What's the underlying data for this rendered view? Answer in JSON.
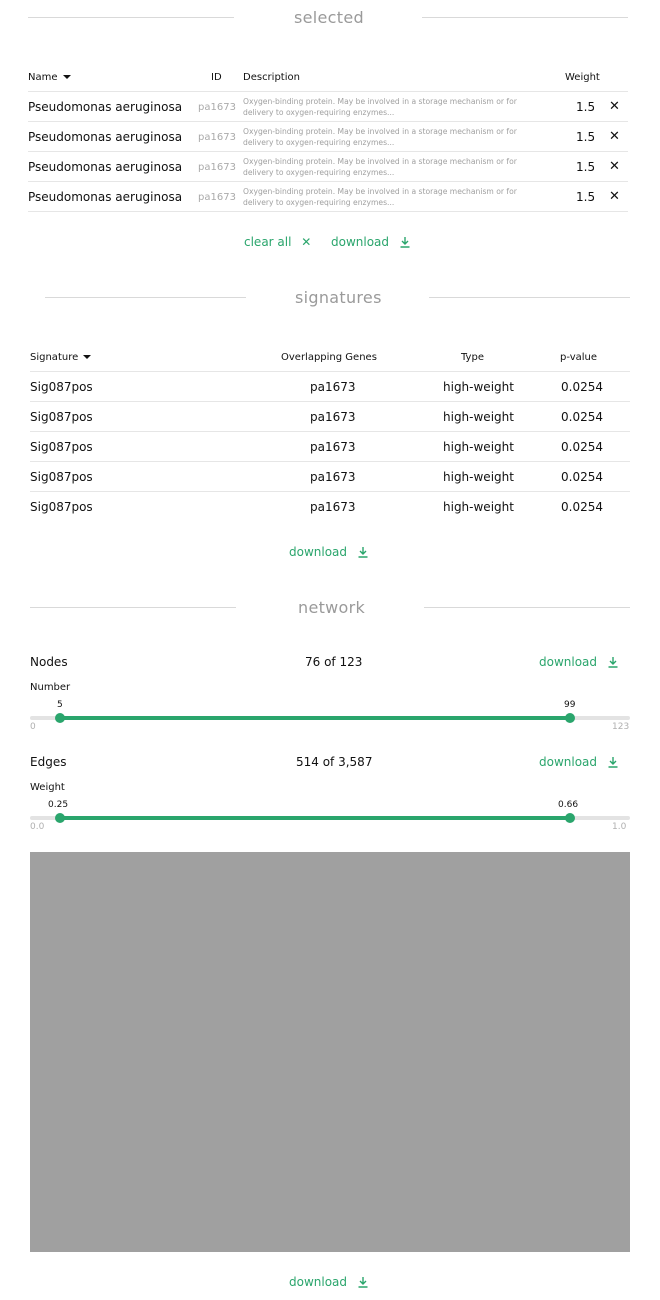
{
  "selected": {
    "title": "selected",
    "headers": {
      "name": "Name",
      "id": "ID",
      "description": "Description",
      "weight": "Weight"
    },
    "rows": [
      {
        "name": "Pseudomonas aeruginosa",
        "id": "pa1673",
        "desc_line1": "Oxygen-binding protein. May be involved in a storage mechanism or for",
        "desc_line2": "delivery to oxygen-requiring enzymes...",
        "weight": "1.5"
      },
      {
        "name": "Pseudomonas aeruginosa",
        "id": "pa1673",
        "desc_line1": "Oxygen-binding protein. May be involved in a storage mechanism or for",
        "desc_line2": "delivery to oxygen-requiring enzymes...",
        "weight": "1.5"
      },
      {
        "name": "Pseudomonas aeruginosa",
        "id": "pa1673",
        "desc_line1": "Oxygen-binding protein. May be involved in a storage mechanism or for",
        "desc_line2": "delivery to oxygen-requiring enzymes...",
        "weight": "1.5"
      },
      {
        "name": "Pseudomonas aeruginosa",
        "id": "pa1673",
        "desc_line1": "Oxygen-binding protein. May be involved in a storage mechanism or for",
        "desc_line2": "delivery to oxygen-requiring enzymes...",
        "weight": "1.5"
      }
    ],
    "remove_glyph": "✕",
    "clear_all_label": "clear all",
    "download_label": "download"
  },
  "signatures": {
    "title": "signatures",
    "headers": {
      "signature": "Signature",
      "overlapping": "Overlapping Genes",
      "type": "Type",
      "pvalue": "p-value"
    },
    "rows": [
      {
        "signature": "Sig087pos",
        "genes": "pa1673",
        "type": "high-weight",
        "pvalue": "0.0254"
      },
      {
        "signature": "Sig087pos",
        "genes": "pa1673",
        "type": "high-weight",
        "pvalue": "0.0254"
      },
      {
        "signature": "Sig087pos",
        "genes": "pa1673",
        "type": "high-weight",
        "pvalue": "0.0254"
      },
      {
        "signature": "Sig087pos",
        "genes": "pa1673",
        "type": "high-weight",
        "pvalue": "0.0254"
      },
      {
        "signature": "Sig087pos",
        "genes": "pa1673",
        "type": "high-weight",
        "pvalue": "0.0254"
      }
    ],
    "download_label": "download"
  },
  "network": {
    "title": "network",
    "nodes": {
      "label": "Nodes",
      "count": "76 of 123",
      "download_label": "download",
      "slider_label": "Number",
      "min_text": "0",
      "max_text": "123",
      "min": 0,
      "max": 123,
      "low": 5,
      "high": 99,
      "low_text": "5",
      "high_text": "99"
    },
    "edges": {
      "label": "Edges",
      "count": "514 of 3,587",
      "download_label": "download",
      "slider_label": "Weight",
      "min_text": "0.0",
      "max_text": "1.0",
      "min": 0,
      "max": 1,
      "low": 0.25,
      "high": 0.66,
      "low_text": "0.25",
      "high_text": "0.66"
    },
    "download_label": "download"
  },
  "colors": {
    "accent": "#2aa56c",
    "muted": "#9a9a9a",
    "canvas": "#a0a0a0"
  },
  "icons": {
    "download": "download-arrow-icon",
    "close": "close-icon",
    "sort": "caret-down-icon"
  }
}
